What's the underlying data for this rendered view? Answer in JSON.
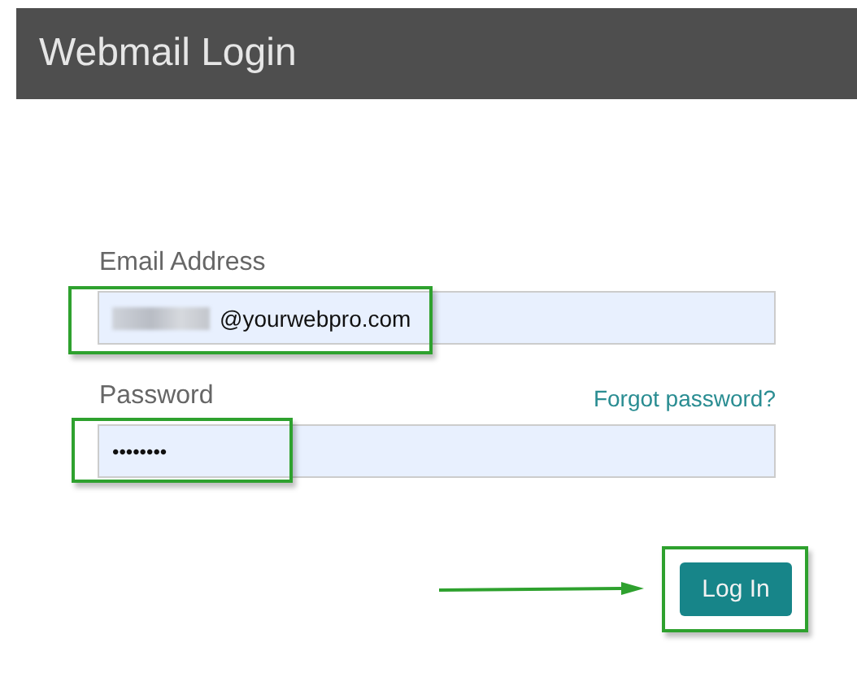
{
  "header": {
    "title": "Webmail Login"
  },
  "fields": [
    {
      "kind": "email",
      "label": "Email Address",
      "value": "@yourwebpro.com",
      "redacted": true,
      "highlighted": true
    },
    {
      "kind": "password",
      "label": "Password",
      "link": "Forgot password?",
      "value": "••••••••",
      "highlighted": true
    }
  ],
  "login_button": {
    "label": "Log In",
    "highlighted": true,
    "arrow": true
  }
}
